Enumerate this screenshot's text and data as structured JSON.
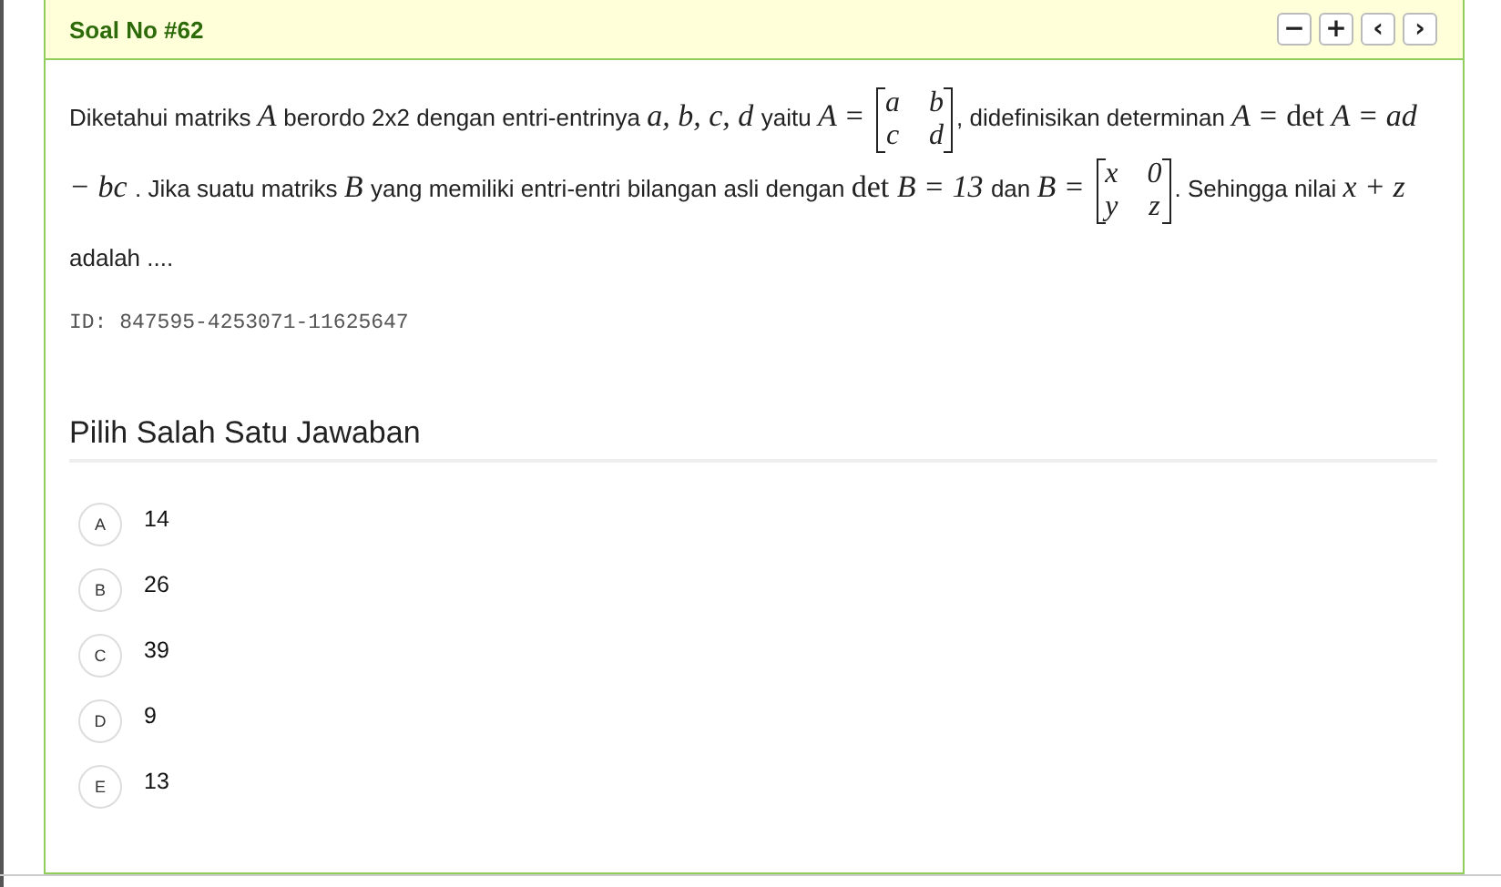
{
  "header": {
    "title": "Soal No #62",
    "buttons": [
      "−",
      "+",
      "‹",
      "›"
    ]
  },
  "question": [
    {
      "kind": "text",
      "text": "Diketahui matriks "
    },
    {
      "kind": "math",
      "text": "A"
    },
    {
      "kind": "text",
      "text": " berordo 2x2 dengan entri-entrinya "
    },
    {
      "kind": "math",
      "text": "a, b, c, d"
    },
    {
      "kind": "text",
      "text": " yaitu "
    },
    {
      "kind": "math",
      "text": "A ="
    },
    {
      "kind": "matrix",
      "rows": [
        [
          "a",
          "b"
        ],
        [
          "c",
          "d"
        ]
      ]
    },
    {
      "kind": "text",
      "text": ", didefinisikan determinan "
    },
    {
      "kind": "math",
      "text": "A ="
    },
    {
      "kind": "op",
      "text": "det"
    },
    {
      "kind": "math",
      "text": "A ="
    },
    {
      "kind": "math",
      "text": "ad − bc"
    },
    {
      "kind": "text",
      "text": ". Jika suatu matriks "
    },
    {
      "kind": "math",
      "text": "B"
    },
    {
      "kind": "text",
      "text": " yang memiliki entri-entri bilangan asli dengan "
    },
    {
      "kind": "op",
      "text": "det"
    },
    {
      "kind": "math",
      "text": "B = 13"
    },
    {
      "kind": "text",
      "text": " dan "
    },
    {
      "kind": "math",
      "text": "B ="
    },
    {
      "kind": "matrix",
      "rows": [
        [
          "x",
          "0"
        ],
        [
          "y",
          "z"
        ]
      ]
    },
    {
      "kind": "text",
      "text": ". Sehingga nilai "
    },
    {
      "kind": "math",
      "text": "x +"
    },
    {
      "kind": "math",
      "text": "z"
    },
    {
      "kind": "text",
      "text": "adalah ...."
    }
  ],
  "id_line": "ID: 847595-4253071-11625647",
  "answers_heading": "Pilih Salah Satu Jawaban",
  "options": [
    {
      "letter": "A",
      "text": "14",
      "selected": false
    },
    {
      "letter": "B",
      "text": "26",
      "selected": false
    },
    {
      "letter": "C",
      "text": "39",
      "selected": false
    },
    {
      "letter": "D",
      "text": "9",
      "selected": false
    },
    {
      "letter": "E",
      "text": "13",
      "selected": false
    }
  ]
}
